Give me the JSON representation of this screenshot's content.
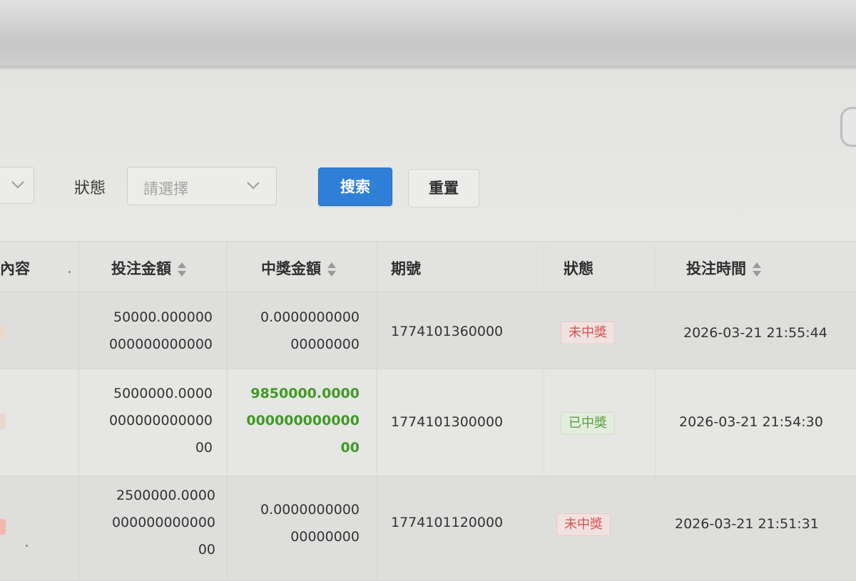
{
  "filters": {
    "status_label": "狀態",
    "status_placeholder": "請選擇",
    "search_button": "搜索",
    "reset_button": "重置"
  },
  "table": {
    "columns": {
      "content": "內容",
      "bet_amount": "投注金額",
      "win_amount": "中獎金額",
      "period": "期號",
      "status": "狀態",
      "bet_time": "投注時間"
    },
    "rows": [
      {
        "bet_amount_lines": [
          "50000.000000",
          "000000000000"
        ],
        "win_amount_lines": [
          "0.0000000000",
          "00000000"
        ],
        "period": "1774101360000",
        "status": "未中獎",
        "status_type": "lose",
        "bet_time": "2026-03-21 21:55:44"
      },
      {
        "bet_amount_lines": [
          "5000000.0000",
          "000000000000",
          "00"
        ],
        "win_amount_lines": [
          "9850000.0000",
          "000000000000",
          "00"
        ],
        "period": "1774101300000",
        "status": "已中獎",
        "status_type": "win",
        "bet_time": "2026-03-21 21:54:30"
      },
      {
        "bet_amount_lines": [
          "2500000.0000",
          "000000000000",
          "00"
        ],
        "win_amount_lines": [
          "0.0000000000",
          "00000000"
        ],
        "period": "1774101120000",
        "status": "未中獎",
        "status_type": "lose",
        "bet_time": "2026-03-21 21:51:31"
      }
    ]
  },
  "colors": {
    "primary": "#2f7fd6",
    "win_text": "#3f9a24",
    "lose_tag": "#d9534f",
    "win_tag": "#5b9f3a"
  },
  "icons": {
    "select_arrow": "chevron-down-icon",
    "sort": "sort-caret-icon"
  }
}
